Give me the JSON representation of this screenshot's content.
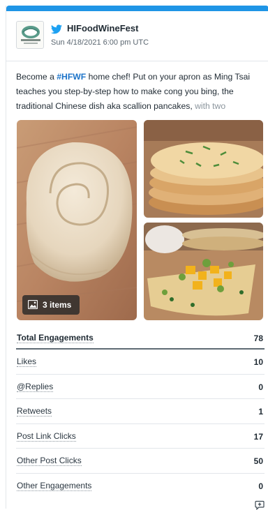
{
  "account": {
    "name": "HIFoodWineFest",
    "timestamp": "Sun 4/18/2021 6:00 pm UTC",
    "avatar_text": "FOOD&WINE"
  },
  "post": {
    "text_before": "Become a ",
    "hashtag": "#HFWF",
    "text_main": " home chef! Put on your apron as Ming Tsai teaches you step-by-step how to make cong you bing, the traditional Chinese dish aka scallion pancakes, ",
    "text_fade": "with two"
  },
  "media": {
    "items_label": "3 items"
  },
  "metrics": [
    {
      "label": "Total Engagements",
      "value": "78"
    },
    {
      "label": "Likes",
      "value": "10"
    },
    {
      "label": "@Replies",
      "value": "0"
    },
    {
      "label": "Retweets",
      "value": "1"
    },
    {
      "label": "Post Link Clicks",
      "value": "17"
    },
    {
      "label": "Other Post Clicks",
      "value": "50"
    },
    {
      "label": "Other Engagements",
      "value": "0"
    }
  ],
  "icons": {
    "network": "twitter-bird-icon",
    "media": "image-icon",
    "action": "comment-add-icon"
  },
  "colors": {
    "top_bar": "#1f95e6",
    "hashtag": "#1d74c9",
    "twitter": "#1da1f2"
  }
}
